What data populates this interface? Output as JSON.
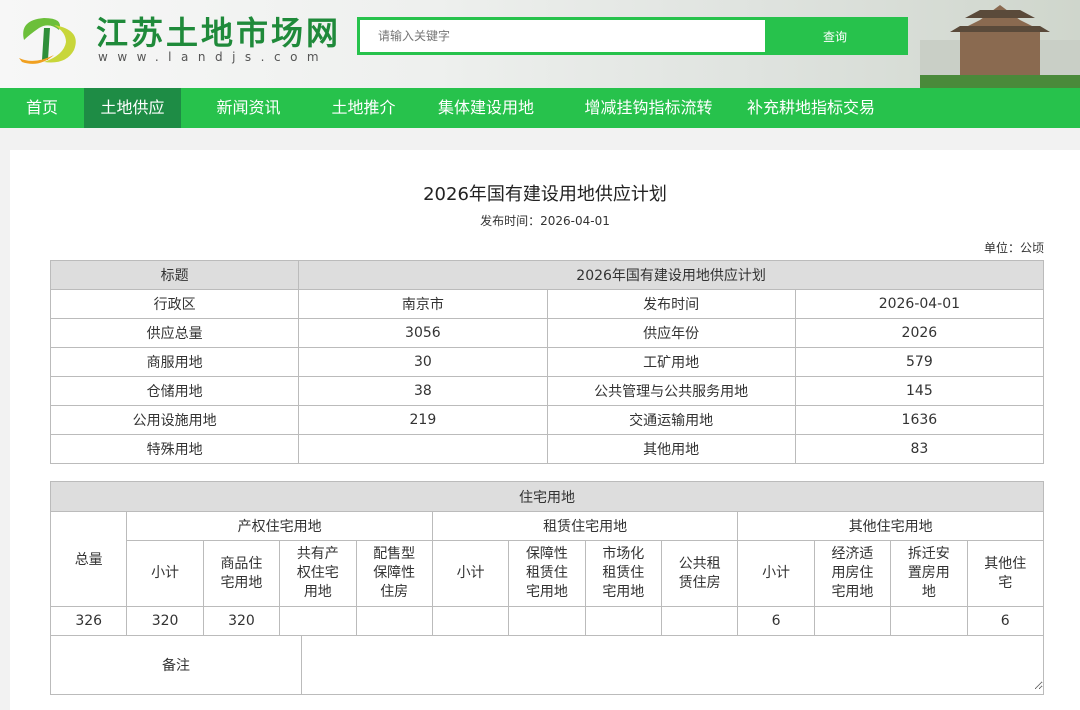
{
  "header": {
    "site_name": "江苏土地市场网",
    "site_url": "www.landjs.com",
    "search_placeholder": "请输入关键字",
    "search_button": "查询"
  },
  "nav": [
    {
      "label": "首页"
    },
    {
      "label": "土地供应",
      "active": true
    },
    {
      "label": "新闻资讯"
    },
    {
      "label": "土地推介"
    },
    {
      "label": "集体建设用地"
    },
    {
      "label": "增减挂钩指标流转"
    },
    {
      "label": "补充耕地指标交易"
    }
  ],
  "article": {
    "title": "2026年国有建设用地供应计划",
    "date": "发布时间：2026-04-01",
    "unit": "单位：公顷"
  },
  "summary": {
    "title_label": "标题",
    "title_value": "2026年国有建设用地供应计划",
    "rows": [
      [
        "行政区",
        "南京市",
        "发布时间",
        "2026-04-01"
      ],
      [
        "供应总量",
        "3056",
        "供应年份",
        "2026"
      ],
      [
        "商服用地",
        "30",
        "工矿用地",
        "579"
      ],
      [
        "仓储用地",
        "38",
        "公共管理与公共服务用地",
        "145"
      ],
      [
        "公用设施用地",
        "219",
        "交通运输用地",
        "1636"
      ],
      [
        "特殊用地",
        "",
        "其他用地",
        "83"
      ]
    ]
  },
  "residential": {
    "header": "住宅用地",
    "total_label": "总量",
    "groups": [
      "产权住宅用地",
      "租赁住宅用地",
      "其他住宅用地"
    ],
    "subheaders": [
      "小计",
      "商品住宅用地",
      "共有产权住宅用地",
      "配售型保障性住房",
      "小计",
      "保障性租赁住宅用地",
      "市场化租赁住宅用地",
      "公共租赁住房",
      "小计",
      "经济适用房住宅用地",
      "拆迁安置房用地",
      "其他住宅"
    ],
    "values": [
      "326",
      "320",
      "320",
      "",
      "",
      "",
      "",
      "",
      "",
      "6",
      "",
      "",
      "6"
    ]
  },
  "notes_label": "备注"
}
